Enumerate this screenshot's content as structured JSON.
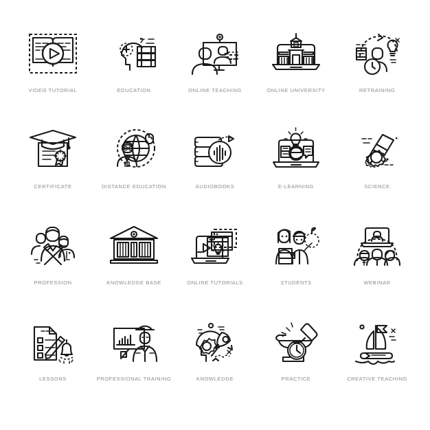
{
  "sheet": {
    "background_color": "#ffffff",
    "label_color": "#8b8b90",
    "line_color": "#1a1a1a",
    "columns": 5,
    "rows": 4
  },
  "icons": [
    {
      "id": "video-tutorial",
      "label": "VIDEO TUTORIAL",
      "glyph": "open-book-with-play-button"
    },
    {
      "id": "education",
      "label": "EDUCATION",
      "glyph": "head-with-plus-and-books"
    },
    {
      "id": "online-teaching",
      "label": "ONLINE TEACHING",
      "glyph": "monitor-with-webcam-and-people"
    },
    {
      "id": "online-university",
      "label": "ONLINE UNIVERSITY",
      "glyph": "university-building-on-laptop"
    },
    {
      "id": "retraining",
      "label": "RETRAINING",
      "glyph": "person-with-book-bulb-and-clock"
    },
    {
      "id": "certificate",
      "label": "CERTIFICATE",
      "glyph": "diploma-with-graduation-cap-and-seal"
    },
    {
      "id": "distance-education",
      "label": "DISTANCE EDUCATION",
      "glyph": "globe-with-student-and-mouse"
    },
    {
      "id": "audiobooks",
      "label": "AUDIOBOOKS",
      "glyph": "book-stack-with-sound-wave"
    },
    {
      "id": "e-learning",
      "label": "E-LEARNING",
      "glyph": "laptop-with-e-and-lightbulb"
    },
    {
      "id": "science",
      "label": "SCIENCE",
      "glyph": "telescope-with-gear"
    },
    {
      "id": "profession",
      "label": "PROFESSION",
      "glyph": "three-people-with-tools"
    },
    {
      "id": "knowledge-base",
      "label": "KNOWLEDGE BASE",
      "glyph": "library-building-with-books"
    },
    {
      "id": "online-tutorials",
      "label": "ONLINE TUTORIALS",
      "glyph": "laptop-with-windows-and-bulb"
    },
    {
      "id": "students",
      "label": "STUDENTS",
      "glyph": "two-students-with-book-and-apple"
    },
    {
      "id": "webinar",
      "label": "WEBINAR",
      "glyph": "laptop-above-group-of-people"
    },
    {
      "id": "lessons",
      "label": "LESSONS",
      "glyph": "checklist-with-pen-and-bell"
    },
    {
      "id": "professional-training",
      "label": "PROFESSIONAL TRAINING",
      "glyph": "presentation-chart-with-worker"
    },
    {
      "id": "knowledge",
      "label": "KNOWLEDGE",
      "glyph": "head-with-gear-and-rocket"
    },
    {
      "id": "practice",
      "label": "PRACTICE",
      "glyph": "anvil-hammer-with-clock"
    },
    {
      "id": "creative-teaching",
      "label": "CREATIVE TEACHING",
      "glyph": "sailboat-with-pencil-hull"
    }
  ]
}
